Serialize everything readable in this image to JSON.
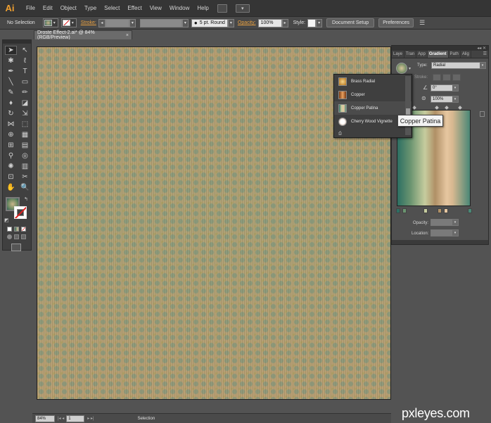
{
  "menubar": {
    "app_logo": "Ai",
    "items": [
      "File",
      "Edit",
      "Object",
      "Type",
      "Select",
      "Effect",
      "View",
      "Window",
      "Help"
    ]
  },
  "controlbar": {
    "selection_label": "No Selection",
    "stroke_label": "Stroke:",
    "brush_value": "5 pt. Round",
    "opacity_label": "Opacity:",
    "opacity_value": "100%",
    "style_label": "Style:",
    "document_setup": "Document Setup",
    "preferences": "Preferences"
  },
  "document": {
    "tab_title": "Droste Effect-2.ai* @ 84% (RGB/Preview)",
    "tab_close": "×"
  },
  "gradient_panel": {
    "tabs": [
      "Laye",
      "Tran",
      "App",
      "Gradient",
      "Path",
      "Alig"
    ],
    "type_label": "Type:",
    "type_value": "Radial",
    "stroke_label": "Stroke:",
    "angle_value": "0°",
    "aspect_value": "100%",
    "opacity_label": "Opacity:",
    "location_label": "Location:"
  },
  "presets": {
    "items": [
      {
        "name": "Brass Radial",
        "color": "#d9a24a"
      },
      {
        "name": "Copper",
        "color": "#c0703a"
      },
      {
        "name": "Copper Patina",
        "color": "#6f9470"
      },
      {
        "name": "Cherry Wood Vignette",
        "color": "#f2e8e0"
      }
    ],
    "tooltip": "Copper Patina"
  },
  "statusbar": {
    "zoom": "84%",
    "page": "1",
    "status": "Selection"
  },
  "watermark": "pxleyes.com",
  "colors": {
    "accent_orange": "#e8a040",
    "panel_bg": "#505050",
    "app_bg": "#535353"
  }
}
